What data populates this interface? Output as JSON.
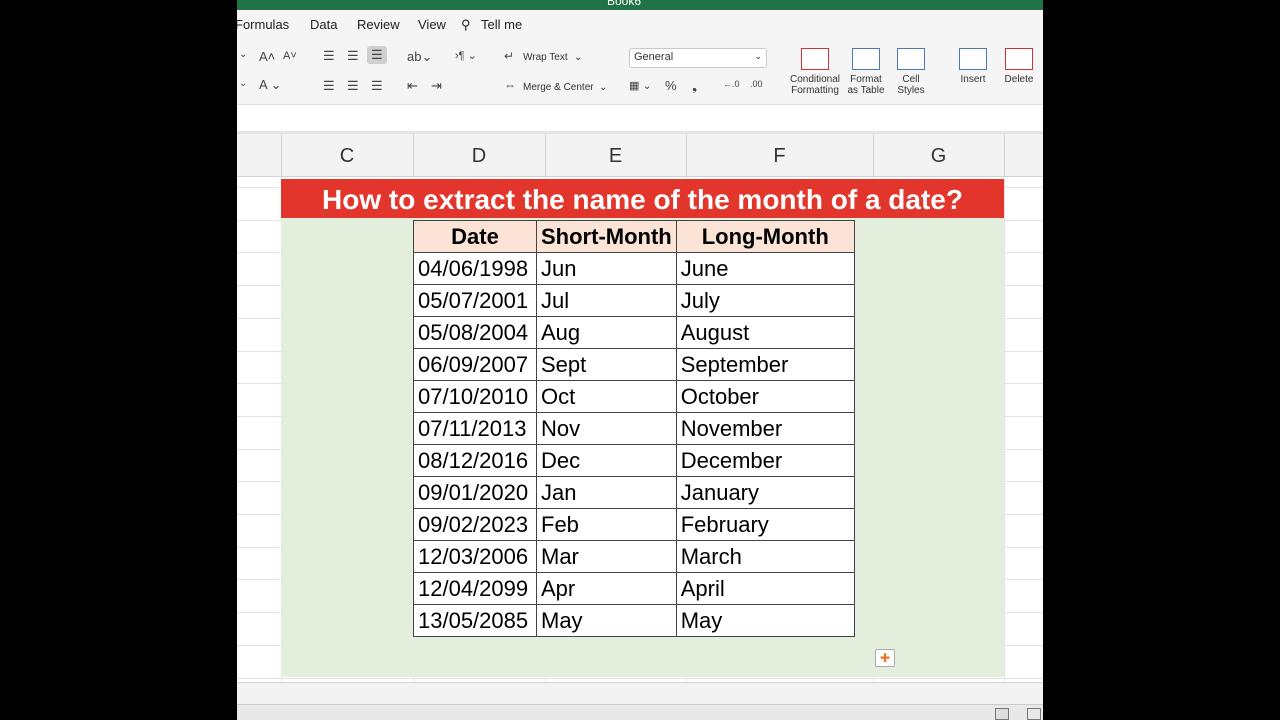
{
  "window": {
    "title": "Book6"
  },
  "menu_tabs": [
    "Formulas",
    "Data",
    "Review",
    "View",
    "Tell me"
  ],
  "ribbon": {
    "wrap_text": "Wrap Text",
    "merge_center": "Merge & Center",
    "number_format": "General",
    "conditional_formatting": [
      "Conditional",
      "Formatting"
    ],
    "format_as_table": [
      "Format",
      "as Table"
    ],
    "cell_styles": [
      "Cell",
      "Styles"
    ],
    "insert": "Insert",
    "delete": "Delete"
  },
  "columns": [
    "C",
    "D",
    "E",
    "F",
    "G"
  ],
  "sheet": {
    "banner": "How to extract the name of the month of a date?",
    "headers": [
      "Date",
      "Short-Month",
      "Long-Month"
    ],
    "rows": [
      [
        "04/06/1998",
        "Jun",
        "June"
      ],
      [
        "05/07/2001",
        "Jul",
        "July"
      ],
      [
        "05/08/2004",
        "Aug",
        "August"
      ],
      [
        "06/09/2007",
        "Sept",
        "September"
      ],
      [
        "07/10/2010",
        "Oct",
        "October"
      ],
      [
        "07/11/2013",
        "Nov",
        "November"
      ],
      [
        "08/12/2016",
        "Dec",
        "December"
      ],
      [
        "09/01/2020",
        "Jan",
        "January"
      ],
      [
        "09/02/2023",
        "Feb",
        "February"
      ],
      [
        "12/03/2006",
        "Mar",
        "March"
      ],
      [
        "12/04/2099",
        "Apr",
        "April"
      ],
      [
        "13/05/2085",
        "May",
        "May"
      ]
    ]
  },
  "colors": {
    "banner": "#e2352b",
    "header_fill": "#fbe4d6",
    "area_fill": "#e3efdc",
    "ribbon_green": "#217346"
  }
}
